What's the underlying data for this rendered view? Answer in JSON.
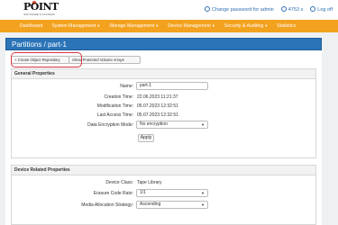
{
  "header": {
    "logo_text": "POINT",
    "logo_sub": "SOFTWARE & SYSTEMS",
    "change_password": "Change password for admin",
    "timer": "4753 s",
    "logoff": "Log off"
  },
  "nav": {
    "items": [
      {
        "label": "Dashboard",
        "dropdown": false
      },
      {
        "label": "System Management",
        "dropdown": true
      },
      {
        "label": "Storage Management",
        "dropdown": true
      },
      {
        "label": "Device Management",
        "dropdown": true
      },
      {
        "label": "Security & Auditing",
        "dropdown": true
      },
      {
        "label": "Statistics",
        "dropdown": false
      }
    ]
  },
  "page": {
    "title": "Partitions / part-1",
    "btn_create": "+ Create Object Repository",
    "btn_protected": "Show Protected Volume Arrays"
  },
  "general": {
    "title": "General Properties",
    "name_label": "Name:",
    "name_value": "part-1",
    "creation_label": "Creation Time:",
    "creation_value": "22.06.2023 11:21:37",
    "modification_label": "Modification Time:",
    "modification_value": "05.07.2023 12:32:51",
    "lastaccess_label": "Last Access Time:",
    "lastaccess_value": "05.07.2023 12:32:51",
    "encryption_label": "Data Encryption Mode:",
    "encryption_value": "No encryption",
    "apply": "Apply"
  },
  "device": {
    "title": "Device Related Properties",
    "class_label": "Device Class:",
    "class_value": "Tape Library",
    "erasure_label": "Erasure Code Rate:",
    "erasure_value": "1/1",
    "media_label": "Media Allocation Strategy:",
    "media_value": "Ascending"
  },
  "colors": {
    "nav_bg": "#f3a21f",
    "header_bg": "#2b74b8",
    "link": "#2f6fb0",
    "highlight": "#d9333f"
  }
}
